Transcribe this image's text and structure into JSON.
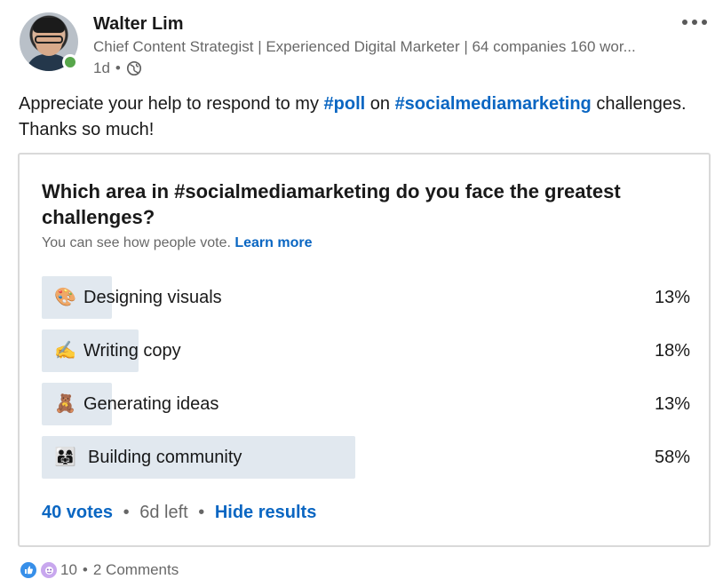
{
  "author": {
    "name": "Walter Lim",
    "headline": "Chief Content Strategist | Experienced Digital Marketer | 64 companies 160 wor...",
    "time": "1d",
    "visibility_icon": "globe-icon"
  },
  "post": {
    "text_before": "Appreciate your help to respond to my ",
    "hashtag_1": "#poll",
    "text_middle": " on ",
    "hashtag_2": "#socialmediamarketing",
    "text_after": " challenges. Thanks so much!"
  },
  "poll": {
    "question": "Which area in #socialmediamarketing do you face the greatest challenges?",
    "note": "You can see how people vote.",
    "learn_more": "Learn more",
    "options": [
      {
        "emoji": "🎨",
        "label": "Designing visuals",
        "percent_label": "13%",
        "percent": 13
      },
      {
        "emoji": "✍️",
        "label": "Writing copy",
        "percent_label": "18%",
        "percent": 18
      },
      {
        "emoji": "🧸",
        "label": "Generating ideas",
        "percent_label": "13%",
        "percent": 13
      },
      {
        "emoji": "👨‍👩‍👧",
        "label": "Building community",
        "percent_label": "58%",
        "percent": 58
      }
    ],
    "votes": "40 votes",
    "time_left": "6d left",
    "hide_results": "Hide results",
    "bar_color": "#e1e8ef"
  },
  "social": {
    "reaction_icons": [
      "like-icon",
      "celebrate-icon"
    ],
    "reaction_count": "10",
    "comments": "2 Comments"
  },
  "colors": {
    "accent": "#0a66c2",
    "online": "#57a64a",
    "like": "#378fe9"
  }
}
